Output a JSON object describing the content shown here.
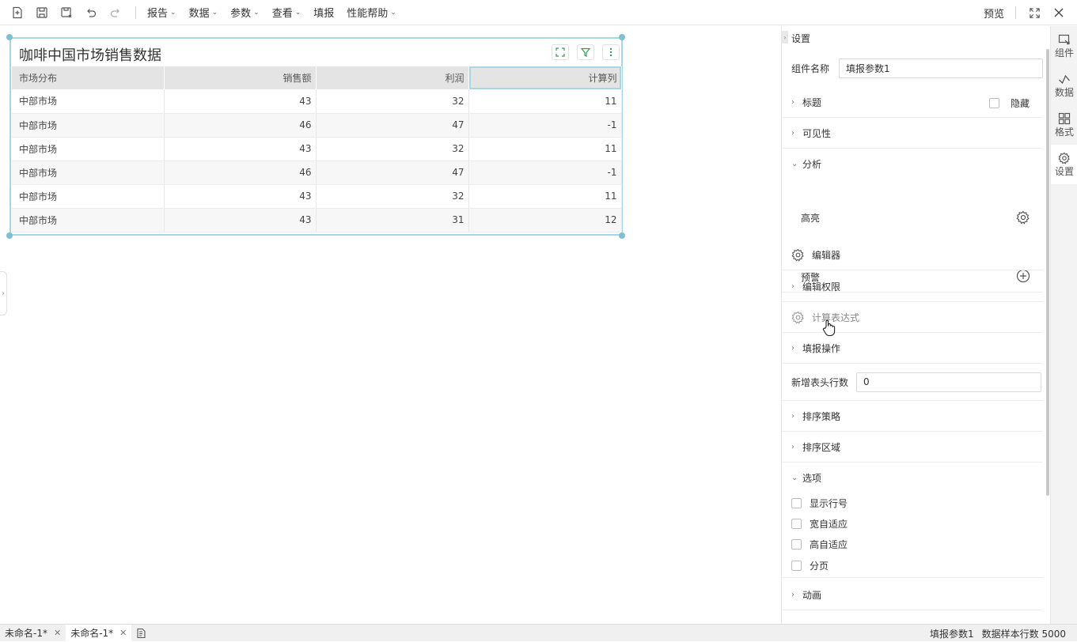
{
  "toolbar": {
    "menus": [
      "报告",
      "数据",
      "参数",
      "查看",
      "填报",
      "性能帮助"
    ],
    "preview_label": "预览"
  },
  "widget": {
    "title": "咖啡中国市场销售数据",
    "columns": [
      "市场分布",
      "销售额",
      "利润",
      "计算列"
    ],
    "rows": [
      [
        "中部市场",
        "43",
        "32",
        "11"
      ],
      [
        "中部市场",
        "46",
        "47",
        "-1"
      ],
      [
        "中部市场",
        "43",
        "32",
        "11"
      ],
      [
        "中部市场",
        "46",
        "47",
        "-1"
      ],
      [
        "中部市场",
        "43",
        "32",
        "11"
      ],
      [
        "中部市场",
        "43",
        "31",
        "12"
      ]
    ]
  },
  "panel": {
    "title": "设置",
    "component_name_label": "组件名称",
    "component_name_value": "填报参数1",
    "sections": {
      "title": "标题",
      "hide": "隐藏",
      "visibility": "可见性",
      "analysis": "分析",
      "highlight": "高亮",
      "warning": "预警",
      "editor": "编辑器",
      "edit_permission": "编辑权限",
      "calc_expression": "计算表达式",
      "fill_operation": "填报操作",
      "new_header_rows_label": "新增表头行数",
      "new_header_rows_value": "0",
      "sort_strategy": "排序策略",
      "sort_area": "排序区域",
      "options": "选项",
      "opt_show_row_number": "显示行号",
      "opt_width_fit": "宽自适应",
      "opt_height_fit": "高自适应",
      "opt_paging": "分页",
      "animation": "动画"
    }
  },
  "strip": {
    "component": "组件",
    "data": "数据",
    "format": "格式",
    "settings": "设置"
  },
  "bottom": {
    "tabs": [
      "未命名-1*",
      "未命名-1*"
    ],
    "status_name": "填报参数1",
    "status_sample": "数据样本行数 5000"
  },
  "colors": {
    "accent": "#a9d6e2",
    "handle": "#7fbfd3",
    "icon_green": "#2e9e5b"
  }
}
